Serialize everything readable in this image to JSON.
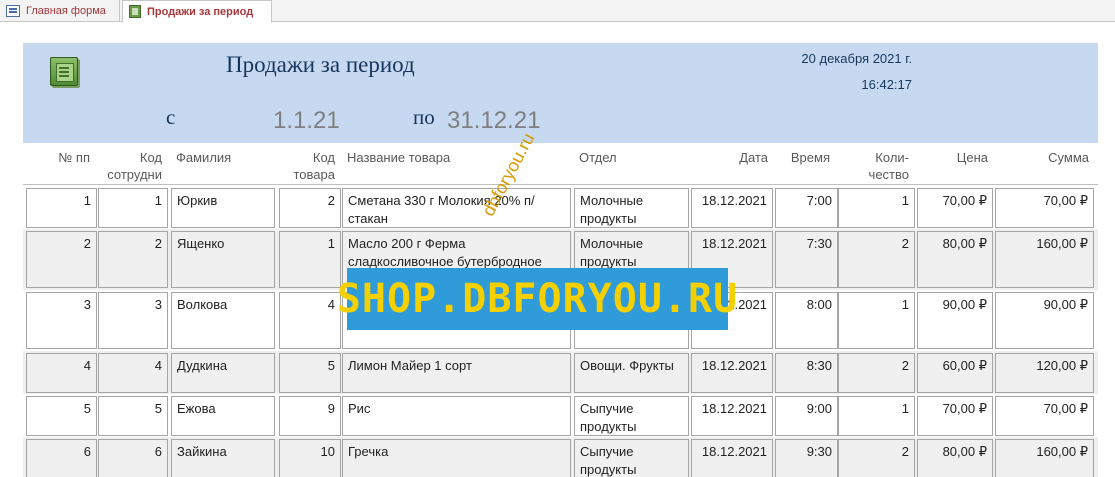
{
  "tabs": [
    {
      "label": "Главная форма"
    },
    {
      "label": "Продажи за период"
    }
  ],
  "header": {
    "title": "Продажи за период",
    "date": "20 декабря 2021 г.",
    "time": "16:42:17",
    "from_label": "с",
    "from_value": "1.1.21",
    "to_label": "по",
    "to_value": "31.12.21"
  },
  "columns": {
    "num": "№ пп",
    "emp_code_1": "Код",
    "emp_code_2": "сотрудни",
    "surname": "Фамилия",
    "prod_code_1": "Код",
    "prod_code_2": "товара",
    "product": "Название товара",
    "dept": "Отдел",
    "date": "Дата",
    "time": "Время",
    "qty_1": "Коли-",
    "qty_2": "чество",
    "price": "Цена",
    "sum": "Сумма"
  },
  "rows": [
    {
      "num": "1",
      "emp": "1",
      "surname": "Юркив",
      "pcode": "2",
      "product": "Сметана 330 г Молокия 20% п/стакан",
      "dept": "Молочные продукты",
      "date": "18.12.2021",
      "time": "7:00",
      "qty": "1",
      "price": "70,00 ₽",
      "sum": "70,00 ₽"
    },
    {
      "num": "2",
      "emp": "2",
      "surname": "Ященко",
      "pcode": "1",
      "product": "Масло 200 г Ферма сладкосливочное бутербродное",
      "dept": "Молочные продукты",
      "date": "18.12.2021",
      "time": "7:30",
      "qty": "2",
      "price": "80,00 ₽",
      "sum": "160,00 ₽"
    },
    {
      "num": "3",
      "emp": "3",
      "surname": "Волкова",
      "pcode": "4",
      "product": "",
      "dept": "",
      "date": "18.12.2021",
      "time": "8:00",
      "qty": "1",
      "price": "90,00 ₽",
      "sum": "90,00 ₽"
    },
    {
      "num": "4",
      "emp": "4",
      "surname": "Дудкина",
      "pcode": "5",
      "product": "Лимон Майер 1 сорт",
      "dept": "Овощи. Фрукты",
      "date": "18.12.2021",
      "time": "8:30",
      "qty": "2",
      "price": "60,00 ₽",
      "sum": "120,00 ₽"
    },
    {
      "num": "5",
      "emp": "5",
      "surname": "Ежова",
      "pcode": "9",
      "product": "Рис",
      "dept": "Сыпучие продукты",
      "date": "18.12.2021",
      "time": "9:00",
      "qty": "1",
      "price": "70,00 ₽",
      "sum": "70,00 ₽"
    },
    {
      "num": "6",
      "emp": "6",
      "surname": "Зайкина",
      "pcode": "10",
      "product": "Гречка",
      "dept": "Сыпучие продукты",
      "date": "18.12.2021",
      "time": "9:30",
      "qty": "2",
      "price": "80,00 ₽",
      "sum": "160,00 ₽"
    }
  ],
  "watermark": {
    "banner": "SHOP.DBFORYOU.RU",
    "diagonal": "dbforyou.ru"
  }
}
